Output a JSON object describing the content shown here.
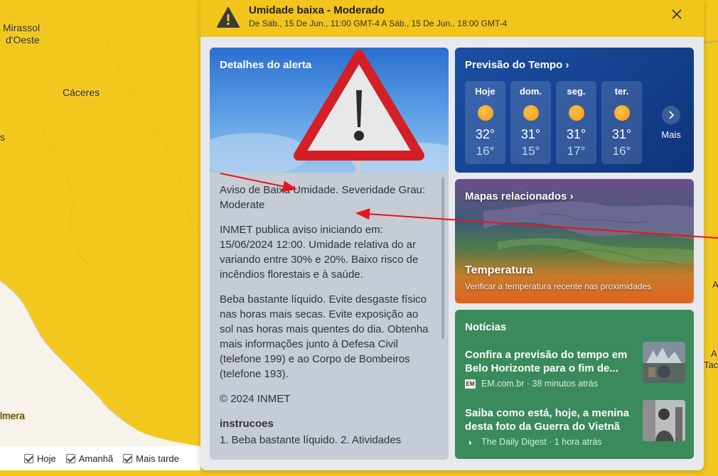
{
  "map": {
    "labels": [
      "Mirassol",
      "d'Oeste",
      "Cáceres",
      "s",
      "lmera",
      "A",
      "Tac",
      "A"
    ]
  },
  "filters": [
    {
      "label": "Hoje"
    },
    {
      "label": "Amanhã"
    },
    {
      "label": "Mais tarde"
    }
  ],
  "alert": {
    "title": "Umidade baixa - Moderado",
    "subtitle": "De Sáb., 15 De Jun., 11:00 GMT-4 A Sáb., 15 De Jun., 18:00 GMT-4"
  },
  "details": {
    "title": "Detalhes do alerta",
    "paragraphs": [
      "Aviso de Baixa Umidade. Severidade Grau: Moderate",
      "INMET publica aviso iniciando em: 15/06/2024 12:00. Umidade relativa do ar variando entre 30% e 20%. Baixo risco de incêndios florestais e à saúde.",
      "Beba bastante líquido. Evite desgaste físico nas horas mais secas. Evite exposição ao sol nas horas mais quentes do dia. Obtenha mais informações junto à Defesa Civil (telefone 199) e ao Corpo de Bombeiros (telefone 193).",
      "© 2024 INMET"
    ],
    "section_title": "instrucoes",
    "section_text": "1. Beba bastante líquido. 2. Atividades"
  },
  "forecast": {
    "title": "Previsão do Tempo",
    "days": [
      {
        "name": "Hoje",
        "high": "32°",
        "low": "16°",
        "icon": "sun-icon"
      },
      {
        "name": "dom.",
        "high": "31°",
        "low": "15°",
        "icon": "sun-icon"
      },
      {
        "name": "seg.",
        "high": "31°",
        "low": "17°",
        "icon": "sun-icon"
      },
      {
        "name": "ter.",
        "high": "31°",
        "low": "16°",
        "icon": "sun-icon"
      }
    ],
    "more_label": "Mais"
  },
  "maps": {
    "title": "Mapas relacionados",
    "name": "Temperatura",
    "subtitle": "Verificar a temperatura recente nas proximidades"
  },
  "news": {
    "title": "Notícias",
    "items": [
      {
        "headline": "Confira a previsão do tempo em Belo Horizonte para o fim de...",
        "source_logo": "EM",
        "source": "EM.com.br",
        "time": "38 minutos atrás"
      },
      {
        "headline": "Saiba como está, hoje, a menina desta foto da Guerra do Vietnã",
        "source_logo": "◗",
        "source": "The Daily Digest",
        "time": "1 hora atrás"
      }
    ]
  },
  "colors": {
    "alert_yellow": "#f2c51c",
    "forecast_blue": "#133f8c",
    "news_green": "#3a8a5c",
    "annotation_red": "#e8141c"
  }
}
